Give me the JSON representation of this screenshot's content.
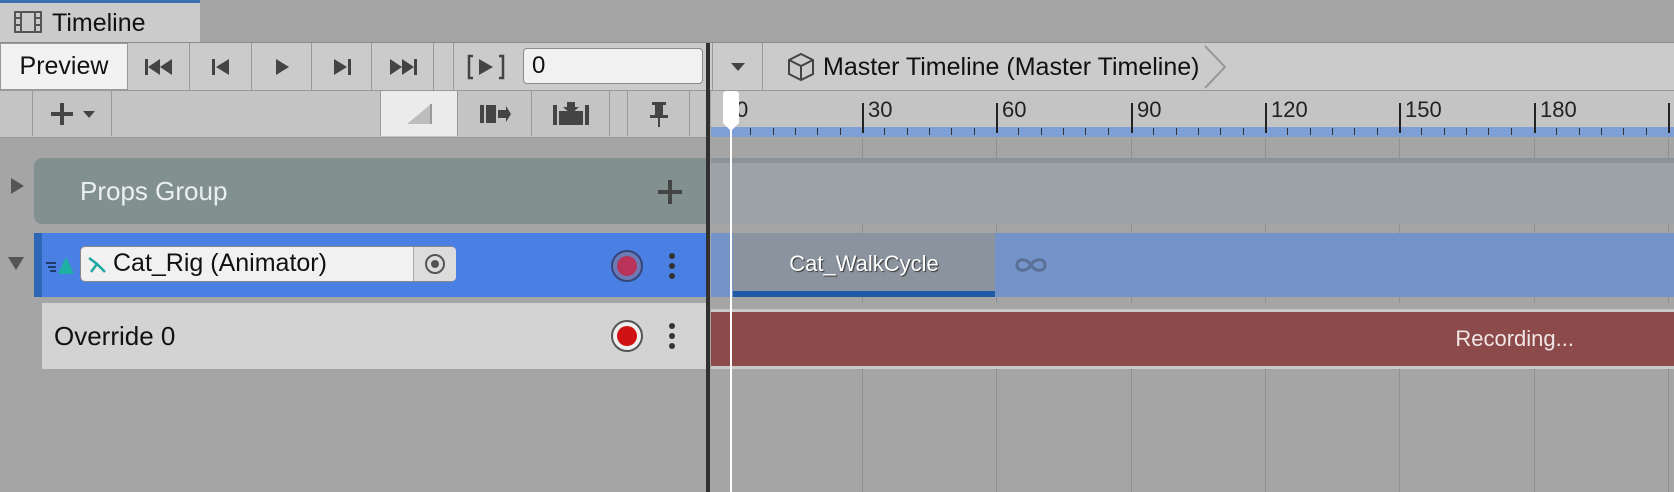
{
  "window": {
    "tab_title": "Timeline",
    "tab_icon": "film-strip-icon"
  },
  "toolbar": {
    "preview_label": "Preview",
    "frame_value": "0",
    "breadcrumb": "Master Timeline (Master Timeline)",
    "icons": [
      "skip-to-start-icon",
      "previous-frame-icon",
      "play-icon",
      "next-frame-icon",
      "skip-to-end-icon",
      "play-range-icon"
    ]
  },
  "ruler": {
    "labels": [
      "0",
      "30",
      "60",
      "90",
      "120",
      "150",
      "180"
    ]
  },
  "tracks": {
    "props_group": {
      "label": "Props Group"
    },
    "cat_rig": {
      "binding": "Cat_Rig (Animator)",
      "clip": "Cat_WalkCycle"
    },
    "override": {
      "label": "Override 0",
      "recording": "Recording..."
    }
  },
  "colors": {
    "selected_track": "#4a7fe3",
    "group_track": "#82918f",
    "recording_bar": "#8c4a4b",
    "ruler_band": "#7e9fd6"
  }
}
